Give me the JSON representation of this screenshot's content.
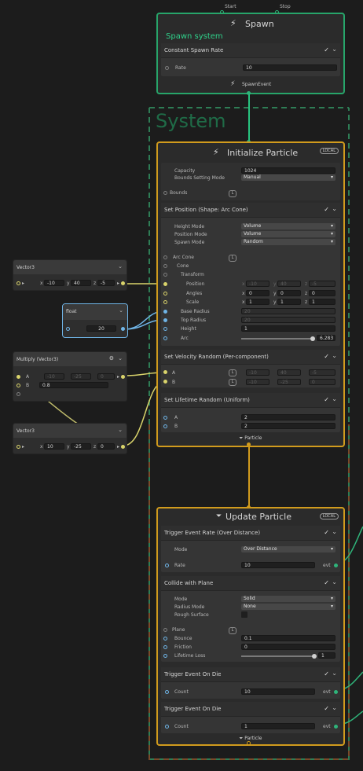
{
  "colors": {
    "spawn_accent": "#27a56a",
    "context_accent": "#d19b1d",
    "float_accent": "#6fb4e6",
    "vector_port": "#d9d36b",
    "system_green": "#2e7d55",
    "system_brown": "#7a4a2a"
  },
  "spawn": {
    "start_label": "Start",
    "stop_label": "Stop",
    "title": "Spawn",
    "subtitle": "Spawn system",
    "block_title": "Constant Spawn Rate",
    "rate_label": "Rate",
    "rate_value": "10",
    "event_label": "SpawnEvent"
  },
  "system": {
    "label": "System"
  },
  "init": {
    "title": "Initialize Particle",
    "local_badge": "LOCAL",
    "capacity_label": "Capacity",
    "capacity_value": "1024",
    "bounds_mode_label": "Bounds Setting Mode",
    "bounds_mode_value": "Manual",
    "bounds_label": "Bounds",
    "bounds_space": "L",
    "set_position": {
      "title": "Set Position (Shape: Arc Cone)",
      "height_mode_label": "Height Mode",
      "height_mode_value": "Volume",
      "position_mode_label": "Position Mode",
      "position_mode_value": "Volume",
      "spawn_mode_label": "Spawn Mode",
      "spawn_mode_value": "Random",
      "arc_cone_label": "Arc Cone",
      "arc_cone_space": "L",
      "cone_label": "Cone",
      "transform_label": "Transform",
      "position_label": "Position",
      "position_x": "-10",
      "position_y": "40",
      "position_z": "-5",
      "angles_label": "Angles",
      "angles_x": "0",
      "angles_y": "0",
      "angles_z": "0",
      "scale_label": "Scale",
      "scale_x": "1",
      "scale_y": "1",
      "scale_z": "1",
      "base_radius_label": "Base Radius",
      "base_radius_value": "20",
      "top_radius_label": "Top Radius",
      "top_radius_value": "20",
      "height_label": "Height",
      "height_value": "1",
      "arc_label": "Arc",
      "arc_value": "6.283",
      "x": "x",
      "y": "y",
      "z": "z"
    },
    "set_velocity": {
      "title": "Set Velocity Random (Per-component)",
      "a_label": "A",
      "a_space": "L",
      "a_x": "-10",
      "a_y": "40",
      "a_z": "-5",
      "b_label": "B",
      "b_space": "L",
      "b_x": "-10",
      "b_y": "-25",
      "b_z": "0"
    },
    "set_lifetime": {
      "title": "Set Lifetime Random (Uniform)",
      "a_label": "A",
      "a_value": "2",
      "b_label": "B",
      "b_value": "2"
    },
    "footer": "Particle"
  },
  "update": {
    "title": "Update Particle",
    "local_badge": "LOCAL",
    "trigger_rate": {
      "title": "Trigger Event Rate (Over Distance)",
      "mode_label": "Mode",
      "mode_value": "Over Distance",
      "rate_label": "Rate",
      "rate_value": "10",
      "evt": "evt"
    },
    "collide": {
      "title": "Collide with Plane",
      "mode_label": "Mode",
      "mode_value": "Solid",
      "radius_mode_label": "Radius Mode",
      "radius_mode_value": "None",
      "rough_label": "Rough Surface",
      "plane_label": "Plane",
      "plane_space": "L",
      "bounce_label": "Bounce",
      "bounce_value": "0.1",
      "friction_label": "Friction",
      "friction_value": "0",
      "lifetime_loss_label": "Lifetime Loss",
      "lifetime_loss_value": "1"
    },
    "die1": {
      "title": "Trigger Event On Die",
      "count_label": "Count",
      "count_value": "10",
      "evt": "evt"
    },
    "die2": {
      "title": "Trigger Event On Die",
      "count_label": "Count",
      "count_value": "1",
      "evt": "evt"
    },
    "footer": "Particle"
  },
  "nodes": {
    "vec3a": {
      "title": "Vector3",
      "x": "-10",
      "y": "40",
      "z": "-5"
    },
    "float": {
      "title": "float",
      "value": "20"
    },
    "multiply": {
      "title": "Multiply (Vector3)",
      "a_label": "A",
      "a_x": "-10",
      "a_y": "-25",
      "a_z": "0",
      "b_label": "B",
      "b_value": "0.8"
    },
    "vec3b": {
      "title": "Vector3",
      "x": "10",
      "y": "-25",
      "z": "0"
    },
    "axis_x": "x",
    "axis_y": "y",
    "axis_z": "z"
  },
  "icons": [
    "lightning-icon",
    "update-icon",
    "checkbox-icon",
    "chevron-down-icon",
    "gear-icon",
    "space-local-icon"
  ]
}
